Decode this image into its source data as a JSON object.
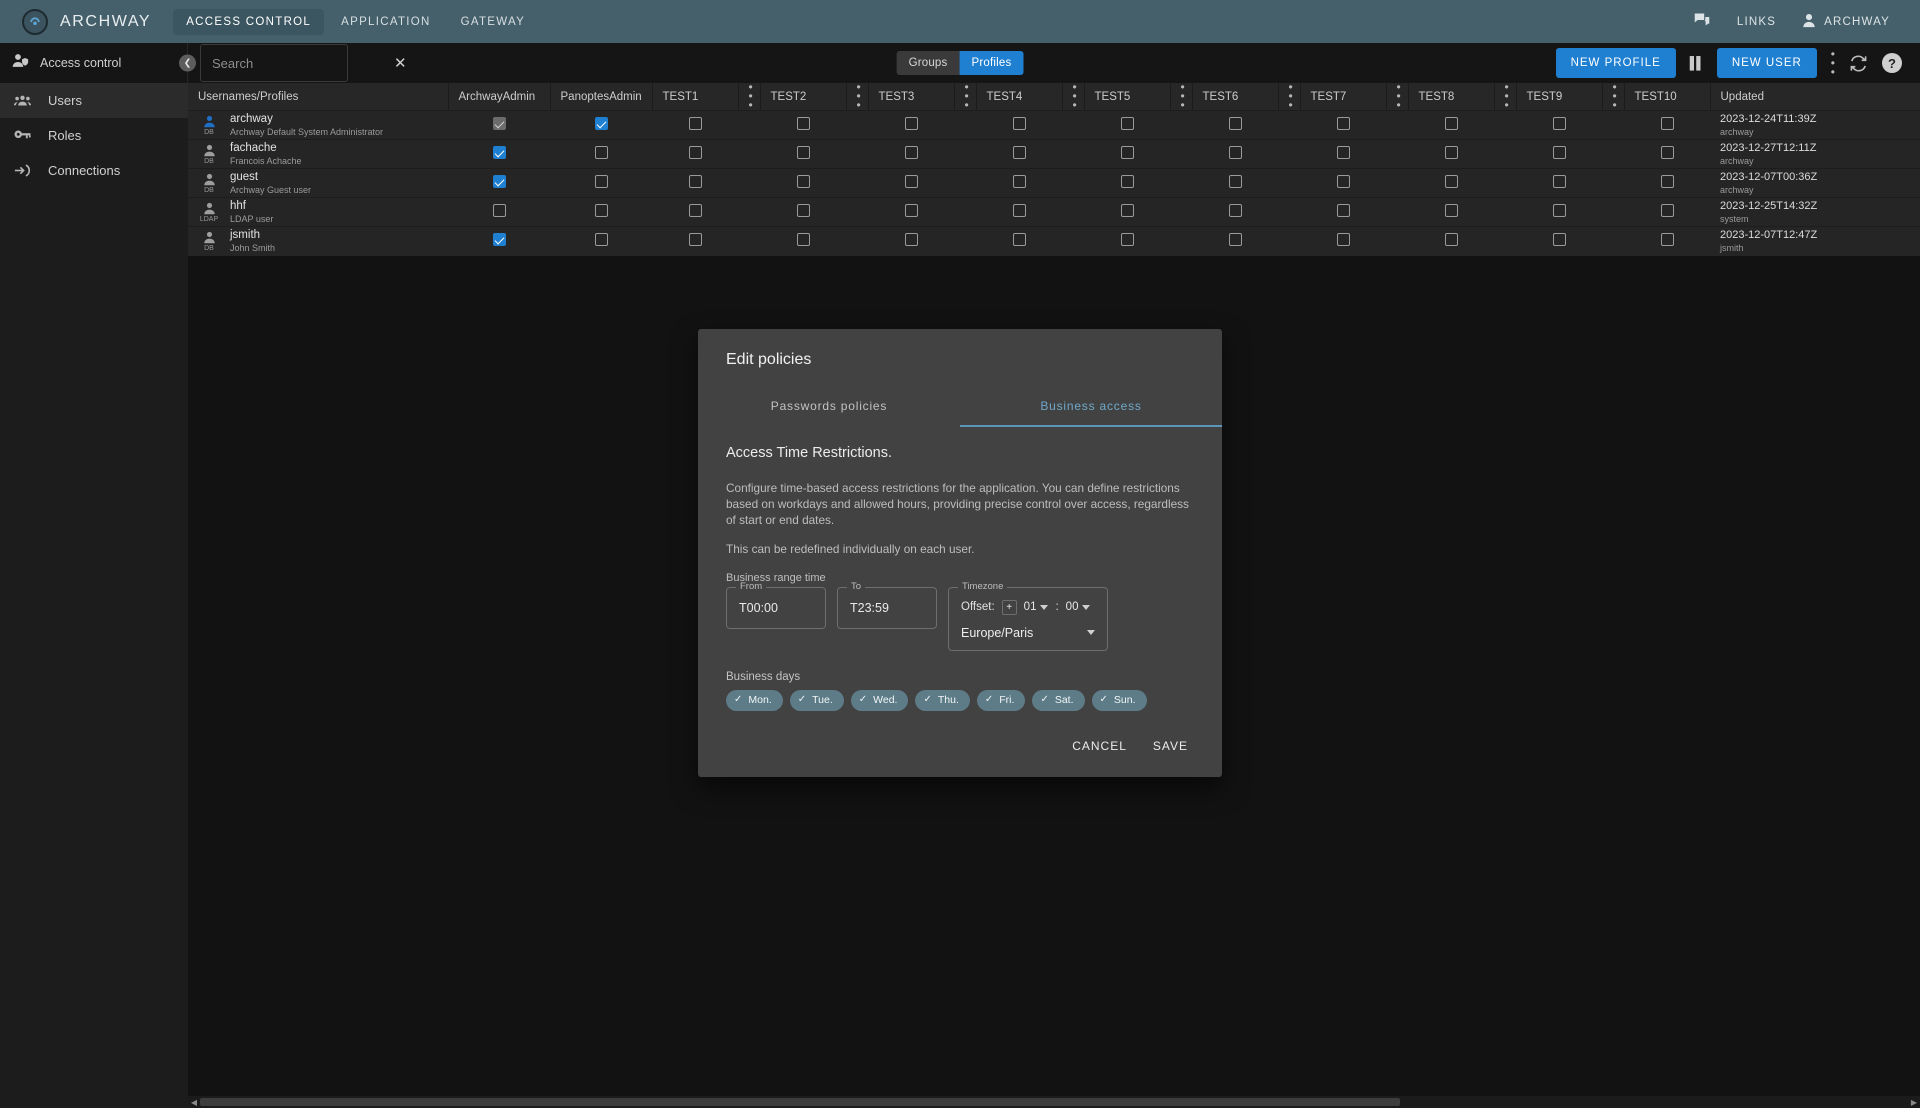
{
  "topbar": {
    "brand": "ARCHWAY",
    "nav": [
      {
        "label": "ACCESS CONTROL",
        "active": true
      },
      {
        "label": "APPLICATION",
        "active": false
      },
      {
        "label": "GATEWAY",
        "active": false
      }
    ],
    "links_label": "LINKS",
    "account_label": "ARCHWAY",
    "accent": "#46606b"
  },
  "toolbar": {
    "section_label": "Access control",
    "search_placeholder": "Search",
    "search_value": "",
    "segments": [
      {
        "label": "Groups",
        "active": false
      },
      {
        "label": "Profiles",
        "active": true
      }
    ],
    "new_profile_label": "NEW PROFILE",
    "new_user_label": "NEW USER",
    "primary_color": "#1f7fd1"
  },
  "sidebar": {
    "items": [
      {
        "label": "Users",
        "icon": "users-icon",
        "active": true
      },
      {
        "label": "Roles",
        "icon": "key-icon",
        "active": false
      },
      {
        "label": "Connections",
        "icon": "login-icon",
        "active": false
      }
    ]
  },
  "table": {
    "columns": [
      "Usernames/Profiles",
      "ArchwayAdmin",
      "PanoptesAdmin",
      "TEST1",
      "TEST2",
      "TEST3",
      "TEST4",
      "TEST5",
      "TEST6",
      "TEST7",
      "TEST8",
      "TEST9",
      "TEST10",
      "Updated"
    ],
    "rows": [
      {
        "username": "archway",
        "description": "Archway Default System Administrator",
        "source": "DB",
        "avatar_color": "#1f6fc4",
        "checks": [
          "disabled-on",
          "on",
          "off",
          "off",
          "off",
          "off",
          "off",
          "off",
          "off",
          "off",
          "off",
          "off"
        ],
        "updated": "2023-12-24T11:39Z",
        "updated_by": "archway"
      },
      {
        "username": "fachache",
        "description": "Francois Achache",
        "source": "DB",
        "avatar_color": "#9e9e9e",
        "checks": [
          "on",
          "off",
          "off",
          "off",
          "off",
          "off",
          "off",
          "off",
          "off",
          "off",
          "off",
          "off"
        ],
        "updated": "2023-12-27T12:11Z",
        "updated_by": "archway"
      },
      {
        "username": "guest",
        "description": "Archway Guest user",
        "source": "DB",
        "avatar_color": "#9e9e9e",
        "checks": [
          "on",
          "off",
          "off",
          "off",
          "off",
          "off",
          "off",
          "off",
          "off",
          "off",
          "off",
          "off"
        ],
        "updated": "2023-12-07T00:36Z",
        "updated_by": "archway"
      },
      {
        "username": "hhf",
        "description": "LDAP user",
        "source": "LDAP",
        "avatar_color": "#9e9e9e",
        "checks": [
          "off",
          "off",
          "off",
          "off",
          "off",
          "off",
          "off",
          "off",
          "off",
          "off",
          "off",
          "off"
        ],
        "updated": "2023-12-25T14:32Z",
        "updated_by": "system"
      },
      {
        "username": "jsmith",
        "description": "John Smith",
        "source": "DB",
        "avatar_color": "#9e9e9e",
        "checks": [
          "on",
          "off",
          "off",
          "off",
          "off",
          "off",
          "off",
          "off",
          "off",
          "off",
          "off",
          "off"
        ],
        "updated": "2023-12-07T12:47Z",
        "updated_by": "jsmith"
      }
    ]
  },
  "dialog": {
    "title": "Edit policies",
    "tabs": [
      {
        "label": "Passwords policies",
        "active": false
      },
      {
        "label": "Business access",
        "active": true
      }
    ],
    "section_title": "Access Time Restrictions.",
    "paragraph1": "Configure time-based access restrictions for the application. You can define restrictions based on workdays and allowed hours, providing precise control over access, regardless of start or end dates.",
    "paragraph2": "This can be redefined individually on each user.",
    "range_legend": "Business range time",
    "from_label": "From",
    "from_value": "T00:00",
    "to_label": "To",
    "to_value": "T23:59",
    "timezone_label": "Timezone",
    "offset_label": "Offset:",
    "offset_sign": "+",
    "offset_hours": "01",
    "offset_sep": ":",
    "offset_minutes": "00",
    "timezone_value": "Europe/Paris",
    "days_label": "Business days",
    "days": [
      {
        "label": "Mon.",
        "selected": true
      },
      {
        "label": "Tue.",
        "selected": true
      },
      {
        "label": "Wed.",
        "selected": true
      },
      {
        "label": "Thu.",
        "selected": true
      },
      {
        "label": "Fri.",
        "selected": true
      },
      {
        "label": "Sat.",
        "selected": true
      },
      {
        "label": "Sun.",
        "selected": true
      }
    ],
    "cancel_label": "CANCEL",
    "save_label": "SAVE",
    "tab_accent": "#5c95b8",
    "chip_color": "#5d7c88"
  }
}
